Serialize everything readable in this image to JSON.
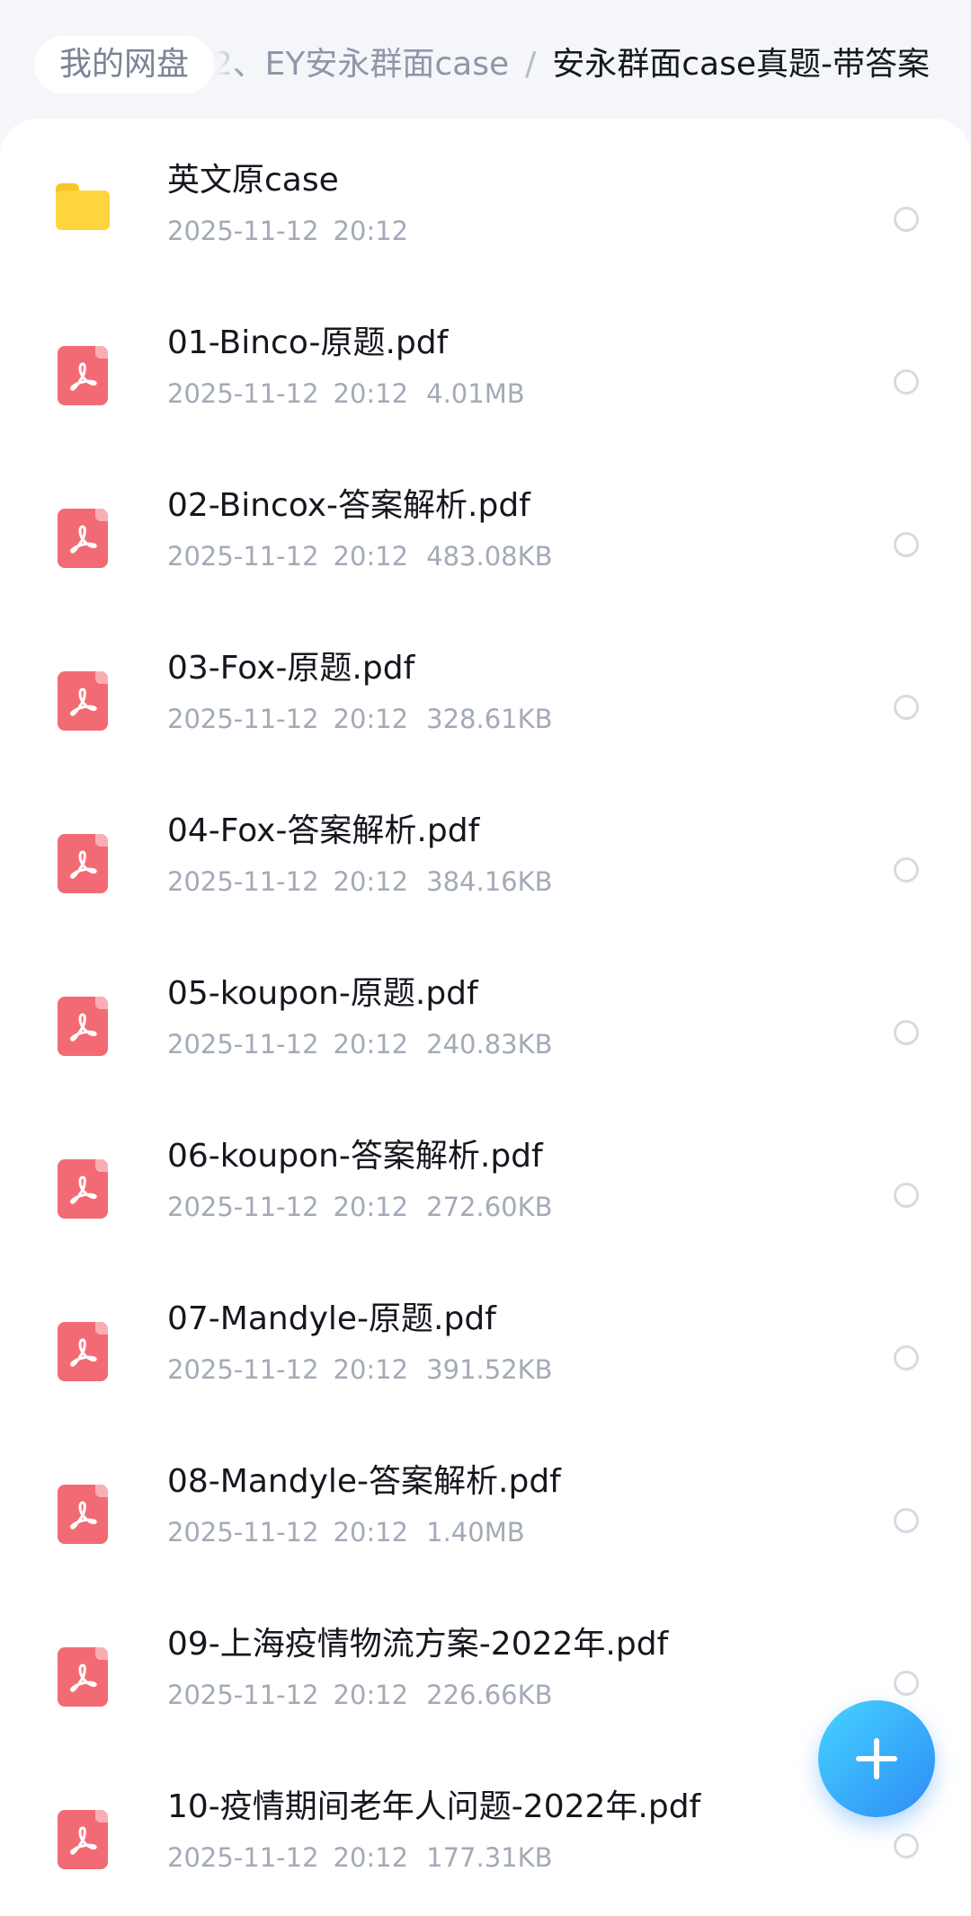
{
  "breadcrumb": {
    "root": "我的网盘",
    "middle": "2、EY安永群面case",
    "separator": "/",
    "current": "安永群面case真题-带答案"
  },
  "files": [
    {
      "type": "folder",
      "name": "英文原case",
      "date": "2025-11-12",
      "time": "20:12",
      "size": ""
    },
    {
      "type": "pdf",
      "name": "01-Binco-原题.pdf",
      "date": "2025-11-12",
      "time": "20:12",
      "size": "4.01MB"
    },
    {
      "type": "pdf",
      "name": "02-Bincox-答案解析.pdf",
      "date": "2025-11-12",
      "time": "20:12",
      "size": "483.08KB"
    },
    {
      "type": "pdf",
      "name": "03-Fox-原题.pdf",
      "date": "2025-11-12",
      "time": "20:12",
      "size": "328.61KB"
    },
    {
      "type": "pdf",
      "name": "04-Fox-答案解析.pdf",
      "date": "2025-11-12",
      "time": "20:12",
      "size": "384.16KB"
    },
    {
      "type": "pdf",
      "name": "05-koupon-原题.pdf",
      "date": "2025-11-12",
      "time": "20:12",
      "size": "240.83KB"
    },
    {
      "type": "pdf",
      "name": "06-koupon-答案解析.pdf",
      "date": "2025-11-12",
      "time": "20:12",
      "size": "272.60KB"
    },
    {
      "type": "pdf",
      "name": "07-Mandyle-原题.pdf",
      "date": "2025-11-12",
      "time": "20:12",
      "size": "391.52KB"
    },
    {
      "type": "pdf",
      "name": "08-Mandyle-答案解析.pdf",
      "date": "2025-11-12",
      "time": "20:12",
      "size": "1.40MB"
    },
    {
      "type": "pdf",
      "name": "09-上海疫情物流方案-2022年.pdf",
      "date": "2025-11-12",
      "time": "20:12",
      "size": "226.66KB"
    },
    {
      "type": "pdf",
      "name": "10-疫情期间老年人问题-2022年.pdf",
      "date": "2025-11-12",
      "time": "20:12",
      "size": "177.31KB"
    }
  ],
  "colors": {
    "folder": "#fed53f",
    "pdf": "#f26b74",
    "fab": "#2d8cf6"
  },
  "icons": {
    "folder": "folder-icon",
    "pdf": "pdf-file-icon",
    "fab": "plus-icon"
  }
}
